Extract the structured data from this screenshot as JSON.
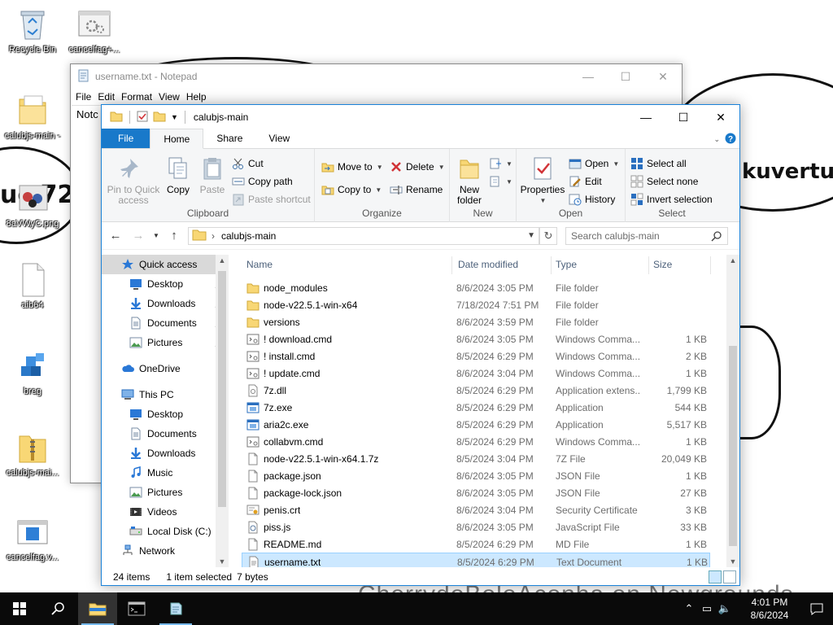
{
  "wallpaper": {
    "text_right": "kuvertu",
    "text_left": "uc  72",
    "credit": "CherrydoBoloAconha on Newgrounds"
  },
  "desktop_icons": [
    {
      "label": "Recycle Bin",
      "icon": "recycle-bin-icon"
    },
    {
      "label": "cancelfag+...",
      "icon": "settings-app-icon"
    },
    {
      "label": "calubjs-main -",
      "icon": "folder-icon"
    },
    {
      "label": "8aVWyC.png",
      "icon": "image-icon"
    },
    {
      "label": "aib64",
      "icon": "blank-file-icon"
    },
    {
      "label": "breg",
      "icon": "registry-cubes-icon"
    },
    {
      "label": "calubjs-mai...",
      "icon": "zip-folder-icon"
    },
    {
      "label": "cancelfag.v...",
      "icon": "window-file-icon"
    }
  ],
  "notepad": {
    "title": "username.txt - Notepad",
    "menu": [
      "File",
      "Edit",
      "Format",
      "View",
      "Help"
    ],
    "content": "Notc"
  },
  "explorer": {
    "title": "calubjs-main",
    "tabs": {
      "file": "File",
      "home": "Home",
      "share": "Share",
      "view": "View"
    },
    "ribbon": {
      "pin": "Pin to Quick access",
      "copy": "Copy",
      "paste": "Paste",
      "cut": "Cut",
      "copy_path": "Copy path",
      "paste_shortcut": "Paste shortcut",
      "clipboard": "Clipboard",
      "move_to": "Move to",
      "copy_to": "Copy to",
      "delete": "Delete",
      "rename": "Rename",
      "organize": "Organize",
      "new_folder": "New folder",
      "new": "New",
      "properties": "Properties",
      "open": "Open",
      "edit": "Edit",
      "history": "History",
      "open_group": "Open",
      "select_all": "Select all",
      "select_none": "Select none",
      "invert_selection": "Invert selection",
      "select_group": "Select"
    },
    "address": {
      "path": "calubjs-main",
      "search_placeholder": "Search calubjs-main"
    },
    "nav": [
      {
        "label": "Quick access",
        "indent": 24,
        "icon": "star-icon",
        "sel": true,
        "pin": false
      },
      {
        "label": "Desktop",
        "indent": 34,
        "icon": "desktop-icon",
        "sel": false,
        "pin": true
      },
      {
        "label": "Downloads",
        "indent": 34,
        "icon": "download-arrow-icon",
        "sel": false,
        "pin": true
      },
      {
        "label": "Documents",
        "indent": 34,
        "icon": "documents-icon",
        "sel": false,
        "pin": true
      },
      {
        "label": "Pictures",
        "indent": 34,
        "icon": "pictures-icon",
        "sel": false,
        "pin": true
      },
      {
        "label": "",
        "indent": 0,
        "icon": "",
        "sel": false,
        "pin": false
      },
      {
        "label": "OneDrive",
        "indent": 24,
        "icon": "cloud-icon",
        "sel": false,
        "pin": false
      },
      {
        "label": "",
        "indent": 0,
        "icon": "",
        "sel": false,
        "pin": false
      },
      {
        "label": "This PC",
        "indent": 24,
        "icon": "computer-icon",
        "sel": false,
        "pin": false
      },
      {
        "label": "Desktop",
        "indent": 34,
        "icon": "desktop-icon",
        "sel": false,
        "pin": false
      },
      {
        "label": "Documents",
        "indent": 34,
        "icon": "documents-icon",
        "sel": false,
        "pin": false
      },
      {
        "label": "Downloads",
        "indent": 34,
        "icon": "download-arrow-icon",
        "sel": false,
        "pin": false
      },
      {
        "label": "Music",
        "indent": 34,
        "icon": "music-icon",
        "sel": false,
        "pin": false
      },
      {
        "label": "Pictures",
        "indent": 34,
        "icon": "pictures-icon",
        "sel": false,
        "pin": false
      },
      {
        "label": "Videos",
        "indent": 34,
        "icon": "videos-icon",
        "sel": false,
        "pin": false
      },
      {
        "label": "Local Disk (C:)",
        "indent": 34,
        "icon": "disk-icon",
        "sel": false,
        "pin": false
      },
      {
        "label": "Network",
        "indent": 24,
        "icon": "network-icon",
        "sel": false,
        "pin": false
      }
    ],
    "columns": {
      "name": "Name",
      "date": "Date modified",
      "type": "Type",
      "size": "Size"
    },
    "files": [
      {
        "name": "node_modules",
        "date": "8/6/2024 3:05 PM",
        "type": "File folder",
        "size": "",
        "icon": "folder-icon"
      },
      {
        "name": "node-v22.5.1-win-x64",
        "date": "7/18/2024 7:51 PM",
        "type": "File folder",
        "size": "",
        "icon": "folder-icon"
      },
      {
        "name": "versions",
        "date": "8/6/2024 3:59 PM",
        "type": "File folder",
        "size": "",
        "icon": "folder-icon"
      },
      {
        "name": "! download.cmd",
        "date": "8/6/2024 3:05 PM",
        "type": "Windows Comma...",
        "size": "1 KB",
        "icon": "cmd-file-icon"
      },
      {
        "name": "! install.cmd",
        "date": "8/5/2024 6:29 PM",
        "type": "Windows Comma...",
        "size": "2 KB",
        "icon": "cmd-file-icon"
      },
      {
        "name": "! update.cmd",
        "date": "8/6/2024 3:04 PM",
        "type": "Windows Comma...",
        "size": "1 KB",
        "icon": "cmd-file-icon"
      },
      {
        "name": "7z.dll",
        "date": "8/5/2024 6:29 PM",
        "type": "Application extens...",
        "size": "1,799 KB",
        "icon": "dll-file-icon"
      },
      {
        "name": "7z.exe",
        "date": "8/5/2024 6:29 PM",
        "type": "Application",
        "size": "544 KB",
        "icon": "exe-file-icon"
      },
      {
        "name": "aria2c.exe",
        "date": "8/5/2024 6:29 PM",
        "type": "Application",
        "size": "5,517 KB",
        "icon": "exe-file-icon"
      },
      {
        "name": "collabvm.cmd",
        "date": "8/5/2024 6:29 PM",
        "type": "Windows Comma...",
        "size": "1 KB",
        "icon": "cmd-file-icon"
      },
      {
        "name": "node-v22.5.1-win-x64.1.7z",
        "date": "8/5/2024 3:04 PM",
        "type": "7Z File",
        "size": "20,049 KB",
        "icon": "blank-file-icon"
      },
      {
        "name": "package.json",
        "date": "8/6/2024 3:05 PM",
        "type": "JSON File",
        "size": "1 KB",
        "icon": "blank-file-icon"
      },
      {
        "name": "package-lock.json",
        "date": "8/6/2024 3:05 PM",
        "type": "JSON File",
        "size": "27 KB",
        "icon": "blank-file-icon"
      },
      {
        "name": "penis.crt",
        "date": "8/6/2024 3:04 PM",
        "type": "Security Certificate",
        "size": "3 KB",
        "icon": "certificate-icon"
      },
      {
        "name": "piss.js",
        "date": "8/6/2024 3:05 PM",
        "type": "JavaScript File",
        "size": "33 KB",
        "icon": "script-file-icon"
      },
      {
        "name": "README.md",
        "date": "8/5/2024 6:29 PM",
        "type": "MD File",
        "size": "1 KB",
        "icon": "blank-file-icon"
      },
      {
        "name": "username.txt",
        "date": "8/5/2024 6:29 PM",
        "type": "Text Document",
        "size": "1 KB",
        "icon": "text-file-icon",
        "selected": true
      }
    ],
    "status": {
      "count": "24 items",
      "selected": "1 item selected",
      "size": "7 bytes"
    }
  },
  "taskbar": {
    "time": "4:01 PM",
    "date": "8/6/2024"
  },
  "colors": {
    "accent": "#1979ca",
    "selection": "#cce8ff",
    "folder": "#f8d775"
  }
}
